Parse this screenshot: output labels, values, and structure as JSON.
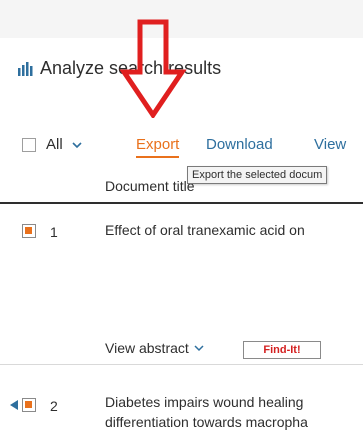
{
  "section": {
    "title": "Analyze search results"
  },
  "toolbar": {
    "all_label": "All",
    "export_label": "Export",
    "download_label": "Download",
    "view_label": "View"
  },
  "columns": {
    "document_label": "Document title"
  },
  "tooltip": {
    "text": "Export the selected docum"
  },
  "results": [
    {
      "number": "1",
      "title": "Effect of oral tranexamic acid on",
      "view_abstract": "View abstract",
      "findit": "Find-It!"
    },
    {
      "number": "2",
      "title_line1": "Diabetes impairs wound healing",
      "title_line2": "differentiation towards macropha"
    }
  ],
  "colors": {
    "accent": "#e9711c",
    "link": "#2e6f9e",
    "annotation_arrow": "#e01f1f"
  }
}
